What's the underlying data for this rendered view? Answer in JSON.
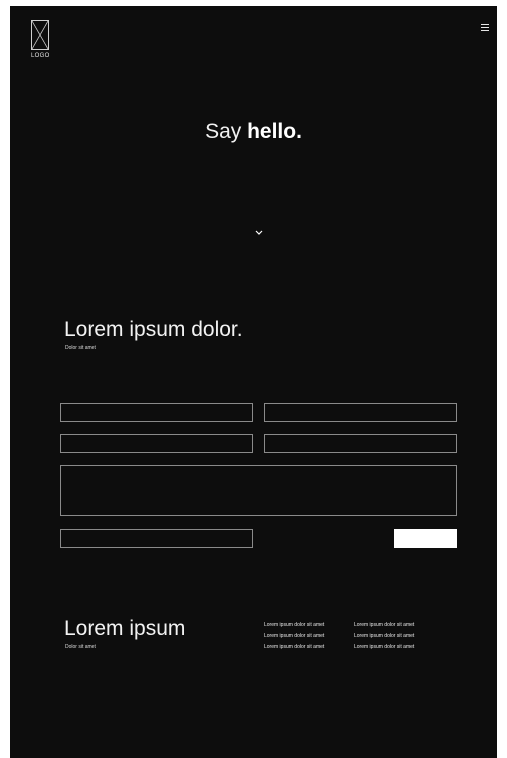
{
  "header": {
    "logo_label": "LOGO",
    "menu_icon": "hamburger-menu-icon"
  },
  "hero": {
    "title_prefix": "Say ",
    "title_emphasis": "hello.",
    "scroll_icon": "chevron-down-icon"
  },
  "contact": {
    "title": "Lorem ipsum dolor.",
    "subtitle": "Dolor sit amet",
    "fields": [
      "",
      "",
      "",
      "",
      "",
      ""
    ],
    "submit_label": ""
  },
  "footer": {
    "title": "Lorem ipsum",
    "subtitle": "Dolor sit amet",
    "links_col1": [
      "Lorem ipsum dolor sit amet",
      "Lorem ipsum dolor sit amet",
      "Lorem ipsum dolor sit amet"
    ],
    "links_col2": [
      "Lorem ipsum dolor sit amet",
      "Lorem ipsum dolor sit amet",
      "Lorem ipsum dolor sit amet"
    ]
  },
  "colors": {
    "background": "#0d0d0d",
    "text": "#ffffff",
    "field_border": "#8a8a8a",
    "button": "#ffffff"
  }
}
